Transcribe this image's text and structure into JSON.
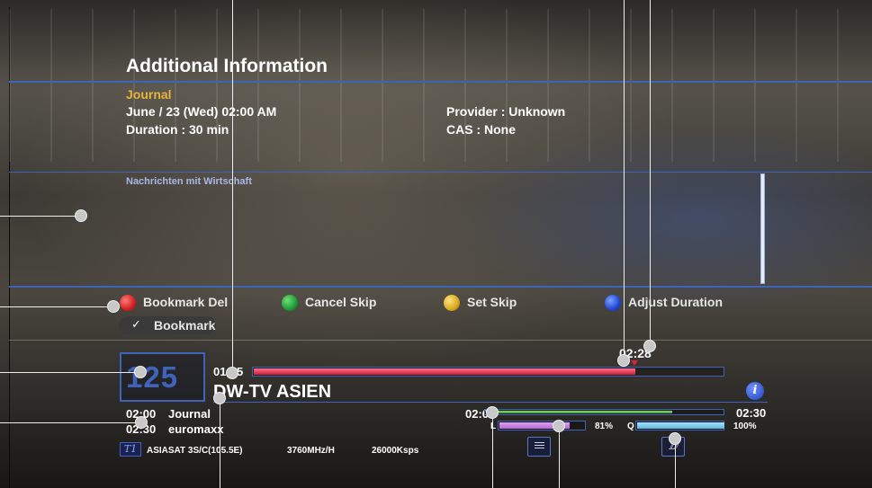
{
  "info": {
    "title": "Additional Information",
    "program_name": "Journal",
    "date_time": "June / 23 (Wed) 02:00 AM",
    "duration": "Duration : 30 min",
    "provider": "Provider : Unknown",
    "cas": "CAS : None",
    "description": "Nachrichten mit Wirtschaft"
  },
  "color_keys": [
    {
      "color": "red",
      "label": "Bookmark Del"
    },
    {
      "color": "green",
      "label": "Cancel Skip"
    },
    {
      "color": "yellow",
      "label": "Set Skip"
    },
    {
      "color": "blue",
      "label": "Adjust Duration"
    }
  ],
  "bookmark_label": "Bookmark",
  "playback": {
    "start_time": "01:55",
    "current_time": "02:28",
    "progress": 0.81
  },
  "channel": {
    "number": "125",
    "name": "DW-TV ASIEN",
    "info_icon": "i"
  },
  "schedule": [
    {
      "time": "02:00",
      "title": "Journal"
    },
    {
      "time": "02:30",
      "title": "euromaxx"
    }
  ],
  "event_bar": {
    "start_time": "02:00",
    "end_time": "02:30",
    "progress": 0.78
  },
  "signal": {
    "level_label": "L",
    "level_value": "81%",
    "level": 0.81,
    "quality_label": "Q",
    "quality_value": "100%",
    "quality": 1.0
  },
  "transponder": {
    "satellite": "ASIASAT 3S/C(105.5E)",
    "frequency": "3760MHz/H",
    "symbol_rate": "26000Ksps",
    "tuner_icon": "T1"
  },
  "icons": {
    "subtitle_icon": "list-icon",
    "audio_icon": "audio-icon"
  },
  "colors": {
    "accent": "#3f63b8",
    "program_name": "#e8b43a",
    "progress_red": "#cc1f3b",
    "event_green": "#3c9a2a",
    "level_purple": "#b46ad6",
    "quality_cyan": "#5fb6e0"
  }
}
